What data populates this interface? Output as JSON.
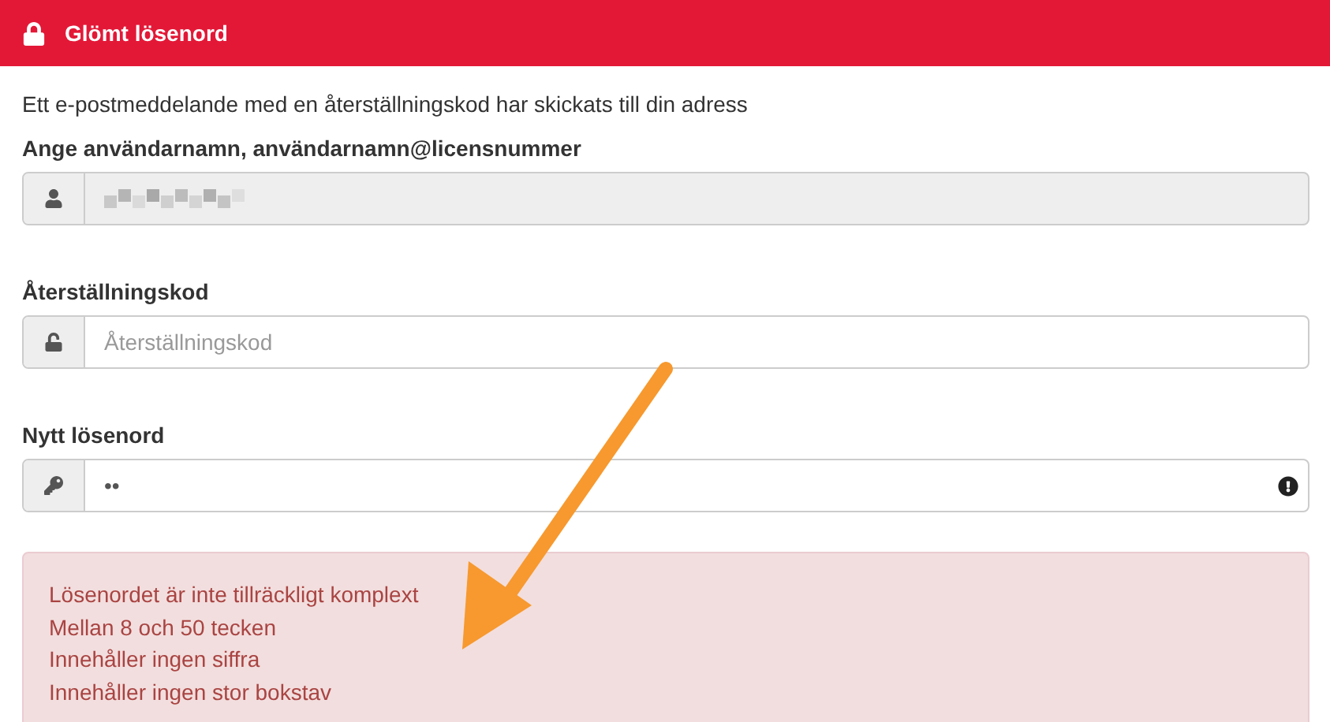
{
  "header": {
    "title": "Glömt lösenord"
  },
  "message": "Ett e-postmeddelande med en återställningskod har skickats till din adress",
  "fields": [
    {
      "label": "Ange användarnamn, användarnamn@licensnummer",
      "kind": "username",
      "disabled": true,
      "invalid": false
    },
    {
      "label": "Återställningskod",
      "kind": "code",
      "placeholder": "Återställningskod",
      "disabled": false,
      "invalid": false
    },
    {
      "label": "Nytt lösenord",
      "kind": "password",
      "value": "••",
      "disabled": false,
      "invalid": true
    }
  ],
  "alert": {
    "lines": [
      "Lösenordet är inte tillräckligt komplext",
      "Mellan 8 och 50 tecken",
      "Innehåller ingen siffra",
      "Innehåller ingen stor bokstav"
    ]
  },
  "annotation": {
    "kind": "arrow"
  }
}
